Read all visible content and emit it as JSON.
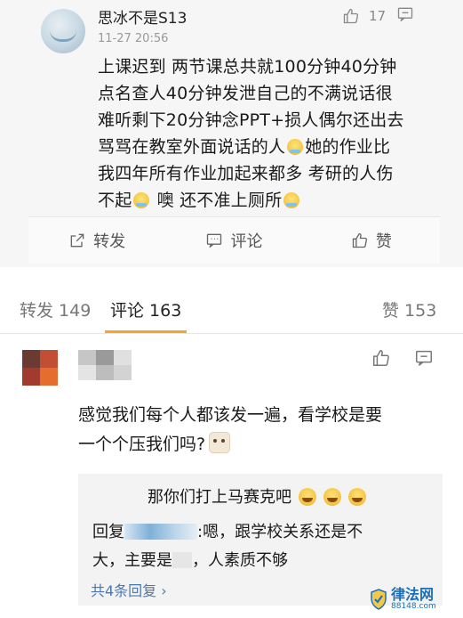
{
  "post": {
    "username": "思冰不是S13",
    "time": "11-27 20:56",
    "like_count": "17",
    "body_lines": [
      "上课迟到  两节课总共就100分钟40分钟",
      "点名查人40分钟发泄自己的不满说话很",
      "难听剩下20分钟念PPT+损人偶尔还出去",
      "骂骂在教室外面说话的人",
      "她的作业比",
      "我四年所有作业加起来都多 考研的人伤",
      "不起",
      " 噢 还不准上厕所"
    ],
    "actions": {
      "repost": "转发",
      "comment": "评论",
      "like": "赞"
    }
  },
  "tabs": {
    "repost": "转发 149",
    "comment": "评论 163",
    "like": "赞 153"
  },
  "comment": {
    "lines": [
      "感觉我们每个人都该发一遍，看学校是要",
      "一个个压我们吗?"
    ],
    "reply_first": "那你们打上马赛克吧",
    "reply_prefix": "回复",
    "reply_rest1": ":嗯，跟学校关系还是不",
    "reply_line2a": "大，主要是",
    "reply_line2b": "，人素质不够",
    "more_replies": "共4条回复 ›"
  },
  "watermark": {
    "title": "律法网",
    "url": "88148.com"
  },
  "colors": {
    "accent": "#f5a623",
    "link": "#4a78b3",
    "watermark": "#1b6fb8"
  }
}
